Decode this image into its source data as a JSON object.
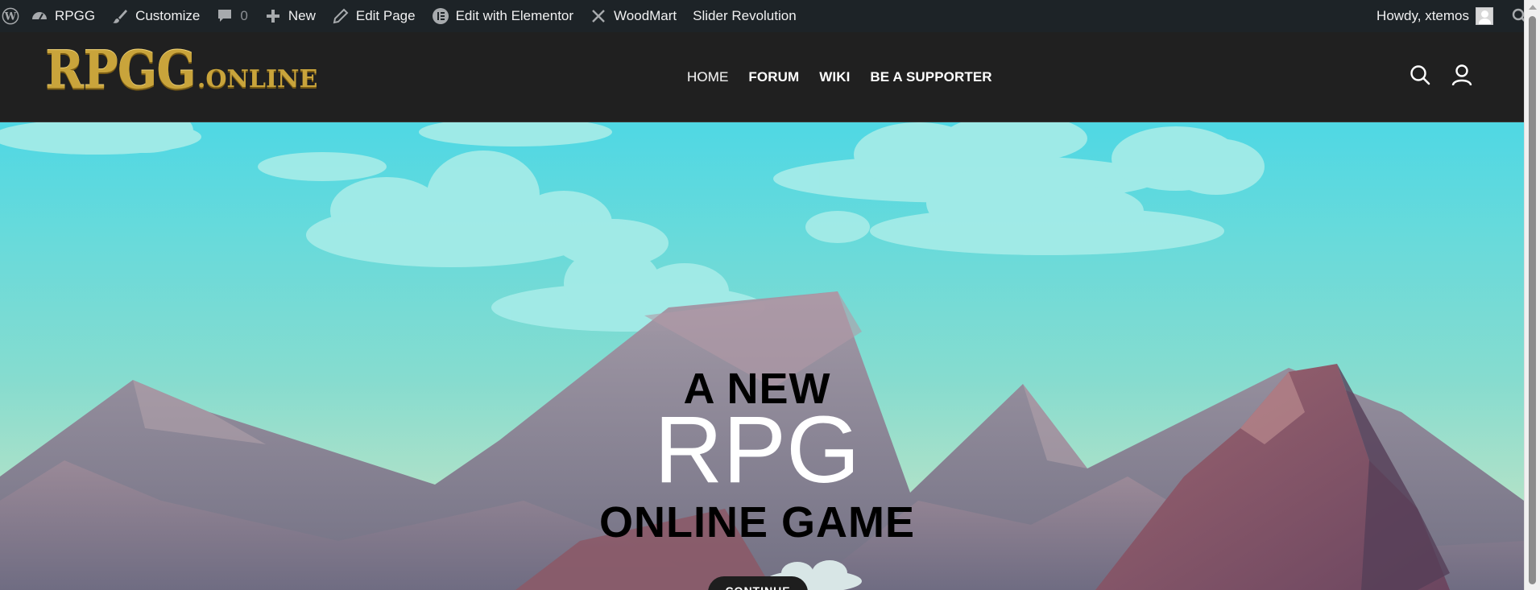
{
  "adminbar": {
    "items": [
      {
        "label": "RPGG",
        "icon": "dashboard-icon"
      },
      {
        "label": "Customize",
        "icon": "brush-icon"
      },
      {
        "label": "0",
        "icon": "comment-icon"
      },
      {
        "label": "New",
        "icon": "plus-icon"
      },
      {
        "label": "Edit Page",
        "icon": "pencil-icon"
      },
      {
        "label": "Edit with Elementor",
        "icon": "elementor-icon"
      },
      {
        "label": "WoodMart",
        "icon": "woodmart-icon"
      },
      {
        "label": "Slider Revolution",
        "icon": ""
      }
    ],
    "greeting": "Howdy, xtemos"
  },
  "header": {
    "logo_main": "RPGG",
    "logo_sub": ".ONLINE",
    "nav": [
      {
        "label": "HOME",
        "active": true
      },
      {
        "label": "FORUM",
        "active": false
      },
      {
        "label": "WIKI",
        "active": false
      },
      {
        "label": "BE A SUPPORTER",
        "active": false
      }
    ]
  },
  "hero": {
    "line1": "A NEW",
    "line2": "RPG",
    "line3": "ONLINE GAME",
    "button": "CONTINUE"
  },
  "colors": {
    "adminbar_bg": "#1d2327",
    "header_bg": "#202020",
    "logo_gold": "#c9a43b",
    "sky_top": "#4fd8e4",
    "sky_bottom": "#c9e8c8"
  }
}
